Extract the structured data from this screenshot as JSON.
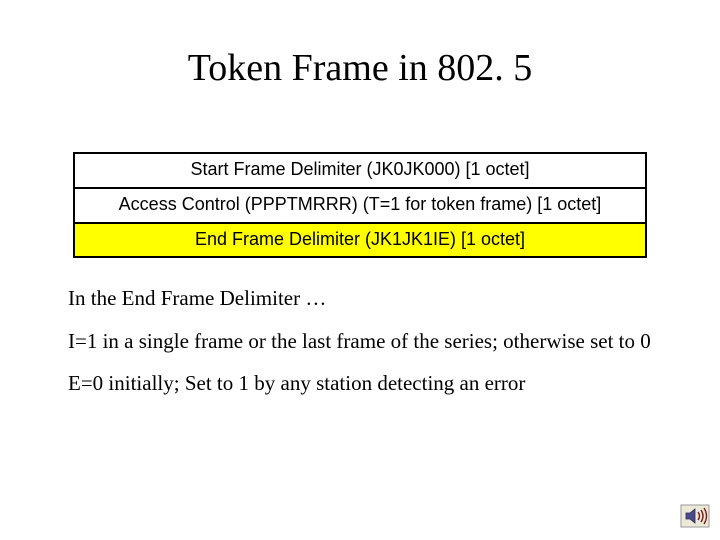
{
  "title": "Token Frame in 802. 5",
  "rows": [
    "Start Frame Delimiter (JK0JK000) [1 octet]",
    "Access Control (PPPTMRRR) (T=1 for token frame) [1 octet]",
    "End Frame Delimiter (JK1JK1IE) [1 octet]"
  ],
  "body": [
    "In the End Frame Delimiter …",
    "I=1 in a single frame or the last frame of the series; otherwise set to 0",
    "E=0 initially;  Set to 1 by any station detecting an error"
  ],
  "icon_name": "sound-icon"
}
